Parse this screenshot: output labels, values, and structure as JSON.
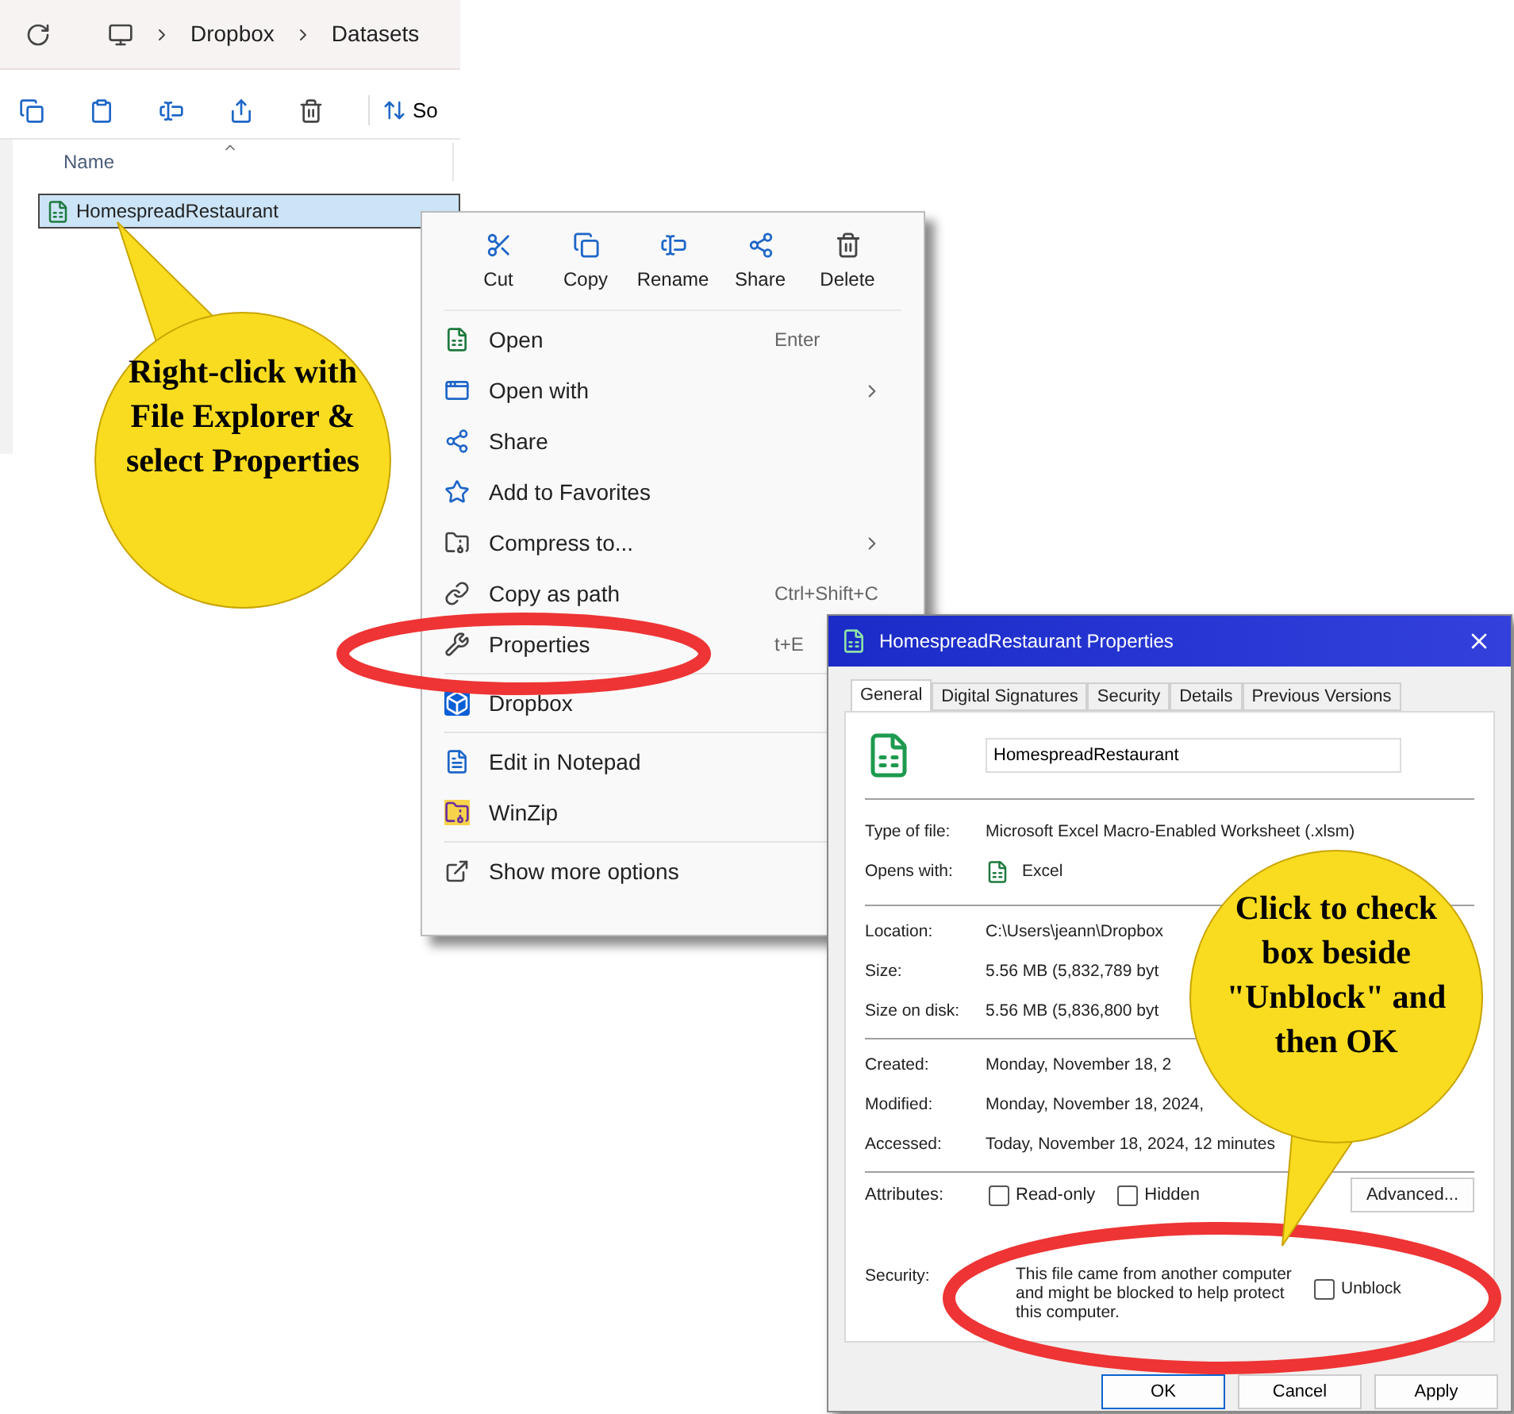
{
  "explorer": {
    "breadcrumb": [
      "Dropbox",
      "Datasets"
    ],
    "toolbar_label": "So",
    "column_header": "Name",
    "files": [
      {
        "name": "HomespreadRestaurant",
        "selected": true
      }
    ]
  },
  "context_menu": {
    "actions": [
      "Cut",
      "Copy",
      "Rename",
      "Share",
      "Delete"
    ],
    "groups": [
      [
        {
          "label": "Open",
          "shortcut": "Enter"
        },
        {
          "label": "Open with",
          "submenu": true
        },
        {
          "label": "Share"
        },
        {
          "label": "Add to Favorites"
        },
        {
          "label": "Compress to...",
          "submenu": true
        },
        {
          "label": "Copy as path",
          "shortcut": "Ctrl+Shift+C"
        },
        {
          "label": "Properties",
          "shortcut": "t+E"
        }
      ],
      [
        {
          "label": "Dropbox"
        }
      ],
      [
        {
          "label": "Edit in Notepad"
        },
        {
          "label": "WinZip"
        }
      ],
      [
        {
          "label": "Show more options"
        }
      ]
    ]
  },
  "properties": {
    "title": "HomespreadRestaurant Properties",
    "tabs": [
      {
        "label": "General",
        "selected": true
      },
      {
        "label": "Digital Signatures",
        "selected": false
      },
      {
        "label": "Security",
        "selected": false
      },
      {
        "label": "Details",
        "selected": false
      },
      {
        "label": "Previous Versions",
        "selected": false
      }
    ],
    "name_field": "HomespreadRestaurant",
    "type_row": {
      "label": "Type of file:",
      "value": "Microsoft Excel Macro-Enabled Worksheet (.xlsm)"
    },
    "opens_with": {
      "label": "Opens with:",
      "value": "Excel"
    },
    "location_rows": [
      {
        "label": "Location:",
        "value": "C:\\Users\\jeann\\Dropbox"
      },
      {
        "label": "Size:",
        "value": "5.56 MB (5,832,789 byt"
      },
      {
        "label": "Size on disk:",
        "value": "5.56 MB (5,836,800 byt"
      }
    ],
    "date_rows": [
      {
        "label": "Created:",
        "value": "Monday, November 18, 2"
      },
      {
        "label": "Modified:",
        "value": "Monday, November 18, 2024,"
      },
      {
        "label": "Accessed:",
        "value": "Today, November 18, 2024, 12 minutes"
      }
    ],
    "attributes": {
      "label": "Attributes:",
      "checkboxes": [
        {
          "label": "Read-only",
          "checked": false
        },
        {
          "label": "Hidden",
          "checked": false
        }
      ],
      "button": "Advanced..."
    },
    "security": {
      "label": "Security:",
      "text": "This file came from another computer and might be blocked to help protect this computer.",
      "checkbox": {
        "label": "Unblock",
        "checked": false
      }
    },
    "buttons": [
      "OK",
      "Cancel",
      "Apply"
    ]
  },
  "callouts": [
    "Right-click with File Explorer & select Properties",
    "Click to check box beside \"Unblock\" and then OK"
  ]
}
